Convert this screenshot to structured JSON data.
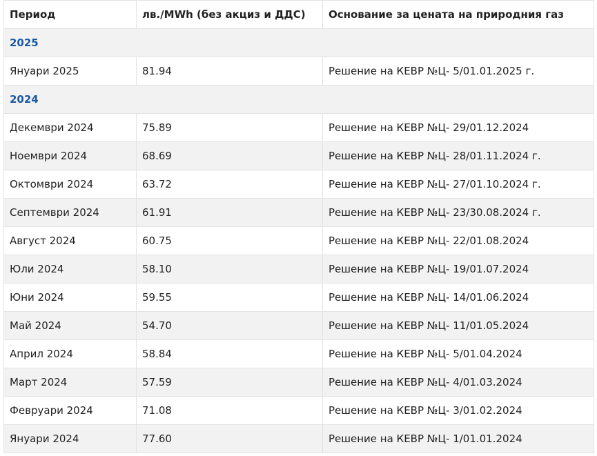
{
  "table": {
    "headers": [
      "Период",
      "лв./MWh (без акциз и ДДС)",
      "Основание за цената на природния газ"
    ],
    "sections": [
      {
        "year": "2025",
        "rows": [
          {
            "period": "Януари 2025",
            "price": "81.94",
            "basis": "Решение на КЕВР №Ц- 5/01.01.2025 г."
          }
        ]
      },
      {
        "year": "2024",
        "rows": [
          {
            "period": "Декември 2024",
            "price": "75.89",
            "basis": "Решение на КЕВР №Ц- 29/01.12.2024"
          },
          {
            "period": "Ноември 2024",
            "price": "68.69",
            "basis": "Решение на КЕВР №Ц- 28/01.11.2024 г."
          },
          {
            "period": "Октомври 2024",
            "price": "63.72",
            "basis": "Решение на КЕВР №Ц- 27/01.10.2024 г."
          },
          {
            "period": "Септември 2024",
            "price": "61.91",
            "basis": "Решение на КЕВР №Ц- 23/30.08.2024 г."
          },
          {
            "period": "Август 2024",
            "price": "60.75",
            "basis": "Решение на КЕВР №Ц- 22/01.08.2024"
          },
          {
            "period": "Юли 2024",
            "price": "58.10",
            "basis": "Решение на КЕВР №Ц- 19/01.07.2024"
          },
          {
            "period": "Юни 2024",
            "price": "59.55",
            "basis": "Решение на КЕВР №Ц- 14/01.06.2024"
          },
          {
            "period": "Май 2024",
            "price": "54.70",
            "basis": "Решение на КЕВР №Ц- 11/01.05.2024"
          },
          {
            "period": "Април 2024",
            "price": "58.84",
            "basis": "Решение на КЕВР №Ц- 5/01.04.2024"
          },
          {
            "period": "Март 2024",
            "price": "57.59",
            "basis": "Решение на КЕВР №Ц- 4/01.03.2024"
          },
          {
            "period": "Февруари 2024",
            "price": "71.08",
            "basis": "Решение на КЕВР №Ц- 3/01.02.2024"
          },
          {
            "period": "Януари 2024",
            "price": "77.60",
            "basis": "Решение на КЕВР №Ц- 1/01.01.2024"
          }
        ]
      }
    ]
  },
  "colors": {
    "year_text": "#1a5aa0",
    "stripe": "#f2f2f2",
    "border": "#e3e3e3"
  }
}
